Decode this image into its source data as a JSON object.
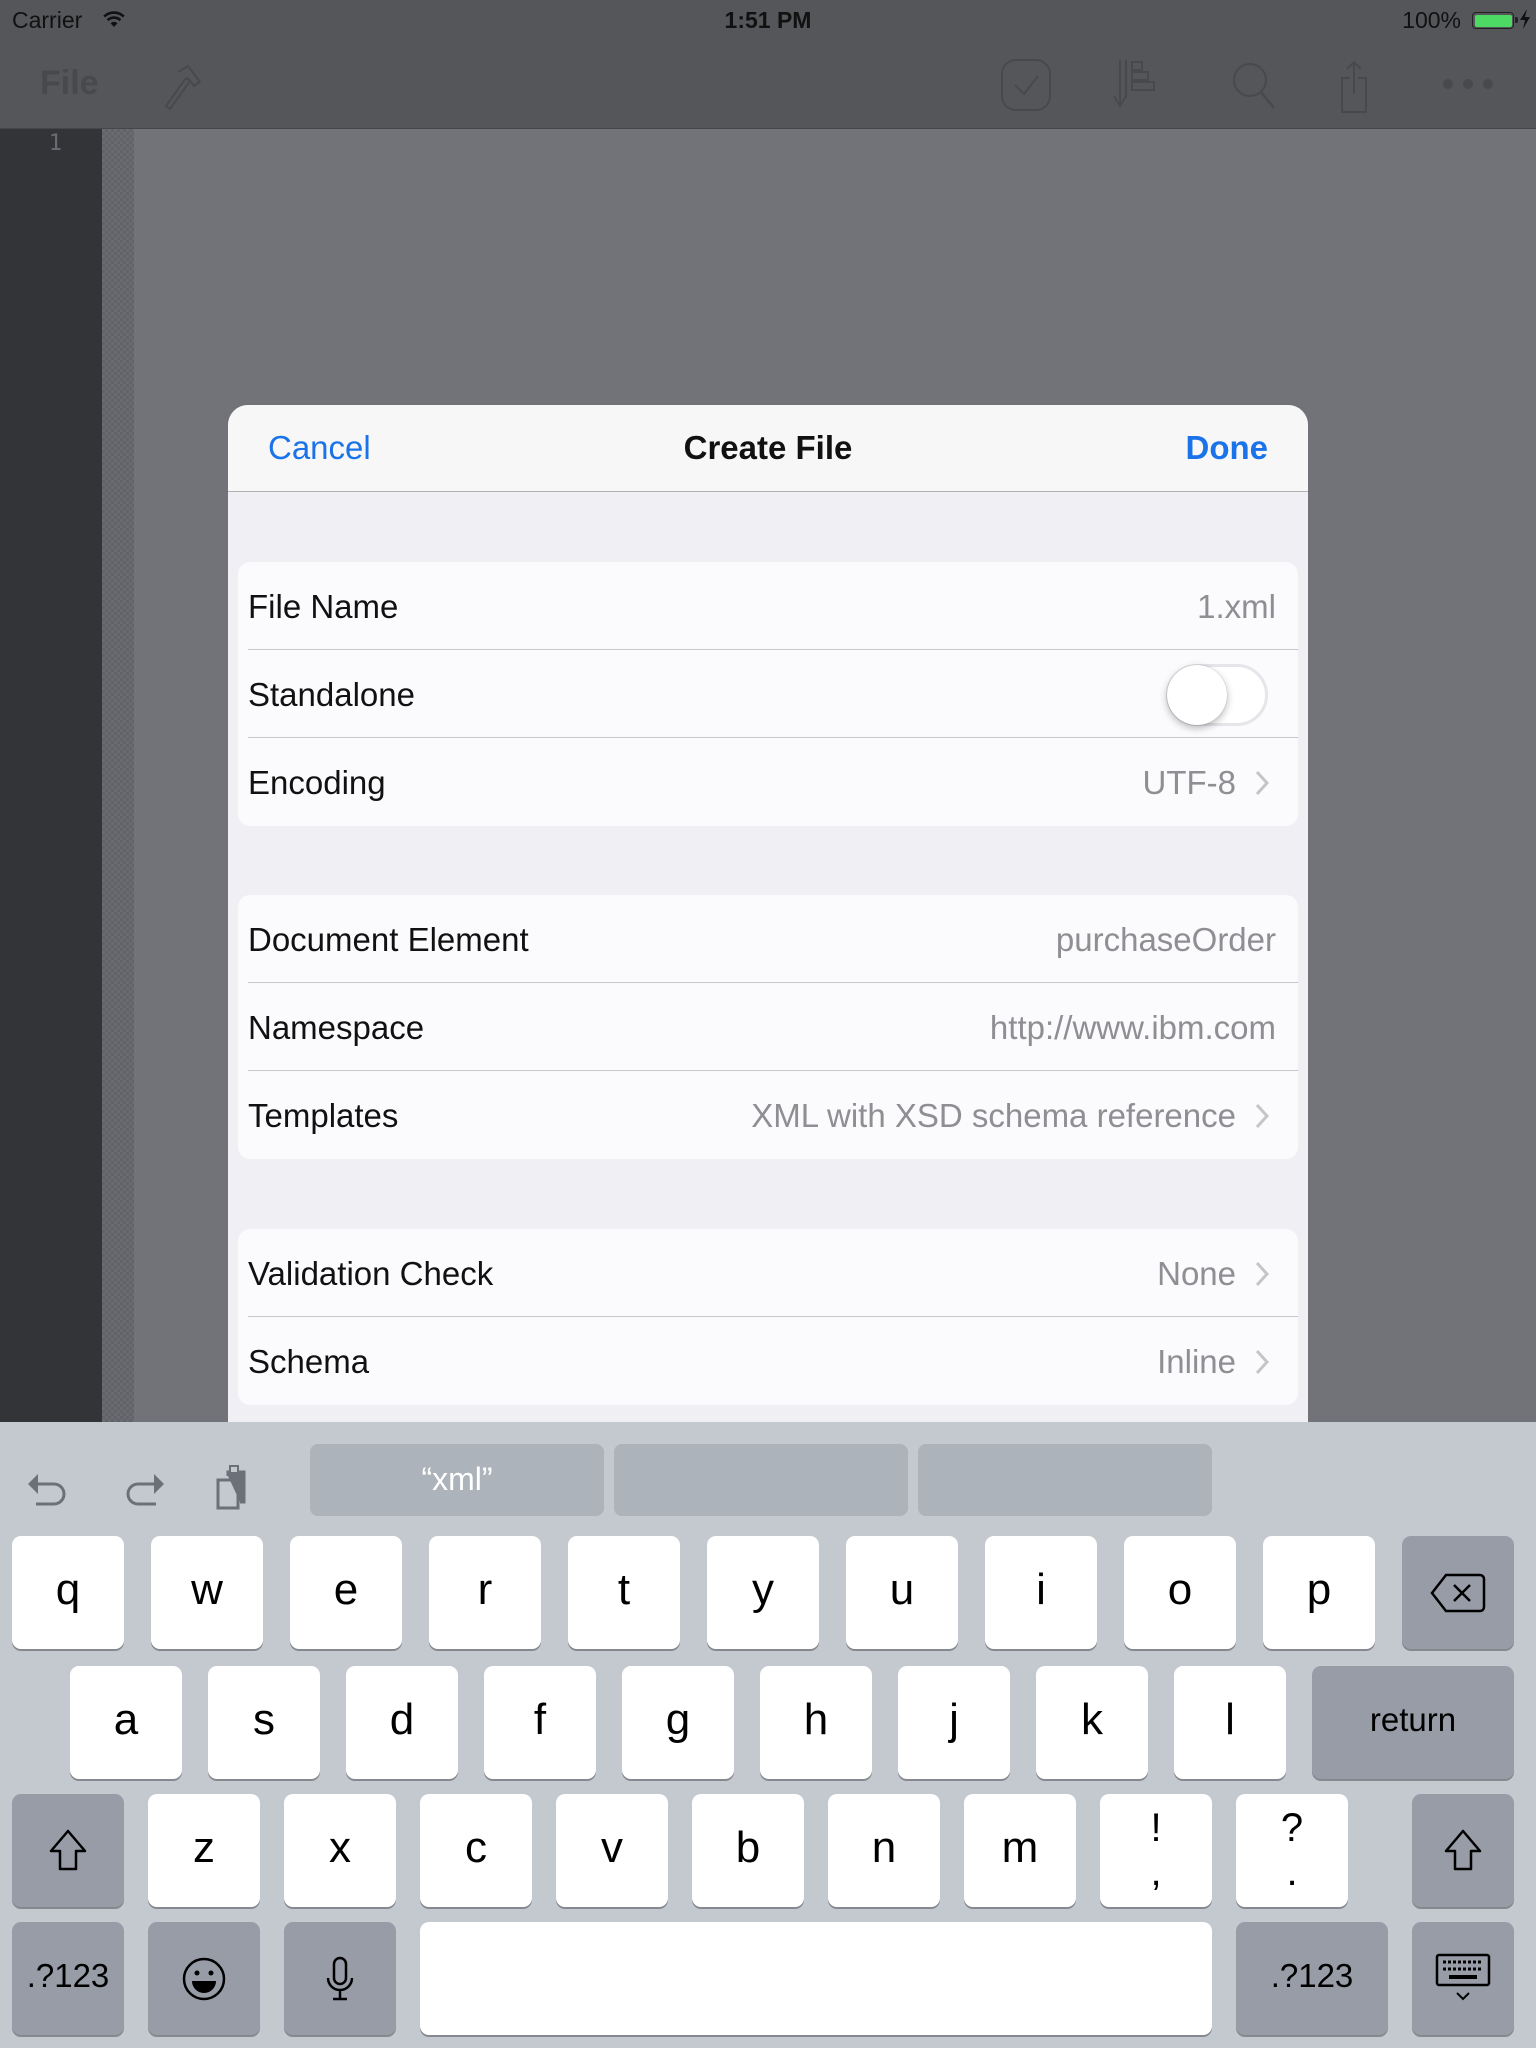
{
  "status_bar": {
    "carrier": "Carrier",
    "time": "1:51 PM",
    "battery_percent": "100%",
    "battery_level": 1.0,
    "charging": true
  },
  "app_nav": {
    "title": "File",
    "icons": [
      "hammer-icon",
      "check-icon",
      "sort-icon",
      "search-icon",
      "share-icon",
      "more-icon"
    ]
  },
  "editor": {
    "line_numbers": [
      "1"
    ]
  },
  "modal": {
    "title": "Create File",
    "cancel_label": "Cancel",
    "done_label": "Done",
    "accent_color": "#1a73e8",
    "groups": [
      {
        "rows": [
          {
            "label": "File Name",
            "value": "1.xml",
            "type": "text"
          },
          {
            "label": "Standalone",
            "value": false,
            "type": "toggle"
          },
          {
            "label": "Encoding",
            "value": "UTF-8",
            "type": "disclosure"
          }
        ]
      },
      {
        "rows": [
          {
            "label": "Document Element",
            "value": "purchaseOrder",
            "type": "text"
          },
          {
            "label": "Namespace",
            "value": "http://www.ibm.com",
            "type": "text"
          },
          {
            "label": "Templates",
            "value": "XML with XSD schema reference",
            "type": "disclosure"
          }
        ]
      },
      {
        "rows": [
          {
            "label": "Validation Check",
            "value": "None",
            "type": "disclosure"
          },
          {
            "label": "Schema",
            "value": "Inline",
            "type": "disclosure"
          }
        ]
      }
    ]
  },
  "keyboard": {
    "toolbar_icons": [
      "undo-icon",
      "redo-icon",
      "paste-icon"
    ],
    "suggestions": [
      "“xml”",
      "",
      ""
    ],
    "row1": [
      "q",
      "w",
      "e",
      "r",
      "t",
      "y",
      "u",
      "i",
      "o",
      "p"
    ],
    "row2": [
      "a",
      "s",
      "d",
      "f",
      "g",
      "h",
      "j",
      "k",
      "l"
    ],
    "row3": [
      "z",
      "x",
      "c",
      "v",
      "b",
      "n",
      "m"
    ],
    "punct_keys": [
      {
        "top": "!",
        "bottom": ","
      },
      {
        "top": "?",
        "bottom": "."
      }
    ],
    "return_label": "return",
    "numbers_label": ".?123"
  }
}
